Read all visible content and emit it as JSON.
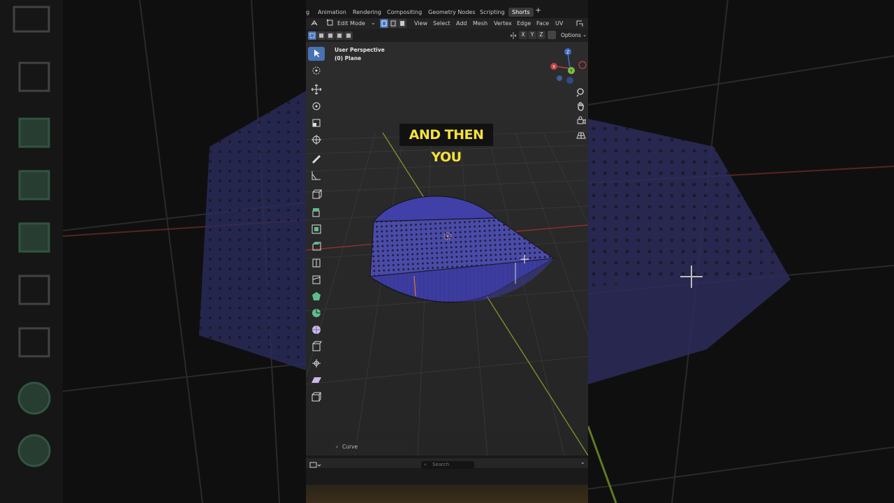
{
  "caption": "AND THEN YOU",
  "workspace_tabs": [
    {
      "label": "g"
    },
    {
      "label": "Animation"
    },
    {
      "label": "Rendering"
    },
    {
      "label": "Compositing"
    },
    {
      "label": "Geometry Nodes"
    },
    {
      "label": "Scripting"
    },
    {
      "label": "Shorts"
    }
  ],
  "active_tab": "Shorts",
  "header": {
    "mode": "Edit Mode",
    "menus": [
      "View",
      "Select",
      "Add",
      "Mesh",
      "Vertex",
      "Edge",
      "Face",
      "UV"
    ],
    "axes": [
      "X",
      "Y",
      "Z"
    ],
    "options_label": "Options"
  },
  "viewport": {
    "view_name": "User Perspective",
    "object_name": "(0) Plane",
    "gizmo_axes": [
      "Z",
      "X",
      "Y"
    ]
  },
  "operator_panel": {
    "label": "Curve"
  },
  "bottom": {
    "search_placeholder": "Search"
  },
  "colors": {
    "accent": "#4772b3",
    "mesh_face": "#3a3a8a",
    "caption_text": "#f5e13c",
    "x_axis": "#b03a3a",
    "y_axis": "#7a9a2a"
  }
}
